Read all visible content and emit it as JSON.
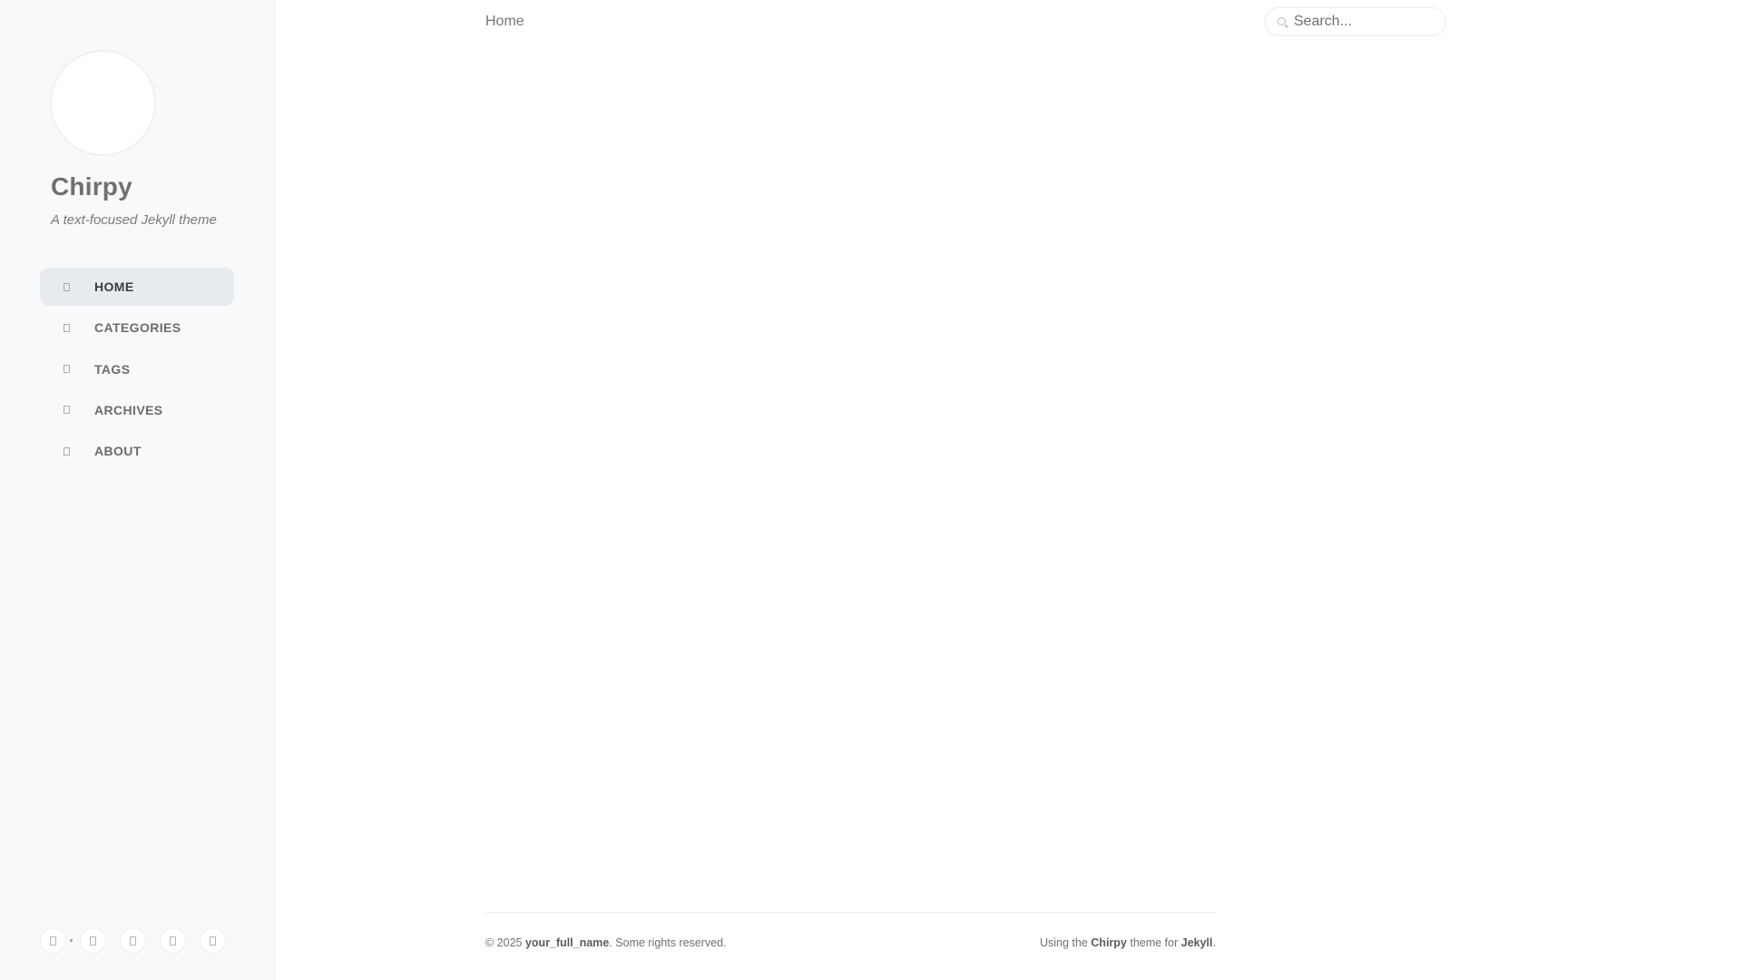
{
  "sidebar": {
    "title": "Chirpy",
    "subtitle": "A text-focused Jekyll theme",
    "nav": [
      {
        "label": "HOME",
        "icon": "home-icon",
        "active": true
      },
      {
        "label": "CATEGORIES",
        "icon": "stream-icon",
        "active": false
      },
      {
        "label": "TAGS",
        "icon": "tag-icon",
        "active": false
      },
      {
        "label": "ARCHIVES",
        "icon": "archive-icon",
        "active": false
      },
      {
        "label": "ABOUT",
        "icon": "info-icon",
        "active": false
      }
    ],
    "bottom_buttons": [
      "mode-toggle-icon",
      "github-icon",
      "twitter-icon",
      "email-icon",
      "rss-icon"
    ]
  },
  "topbar": {
    "breadcrumb": "Home",
    "search_placeholder": "Search..."
  },
  "footer": {
    "copyright_prefix": "© 2025 ",
    "author": "your_full_name",
    "rights": ". Some rights reserved.",
    "using_prefix": "Using the ",
    "theme_name": "Chirpy",
    "theme_mid": " theme for ",
    "engine": "Jekyll",
    "end": "."
  }
}
